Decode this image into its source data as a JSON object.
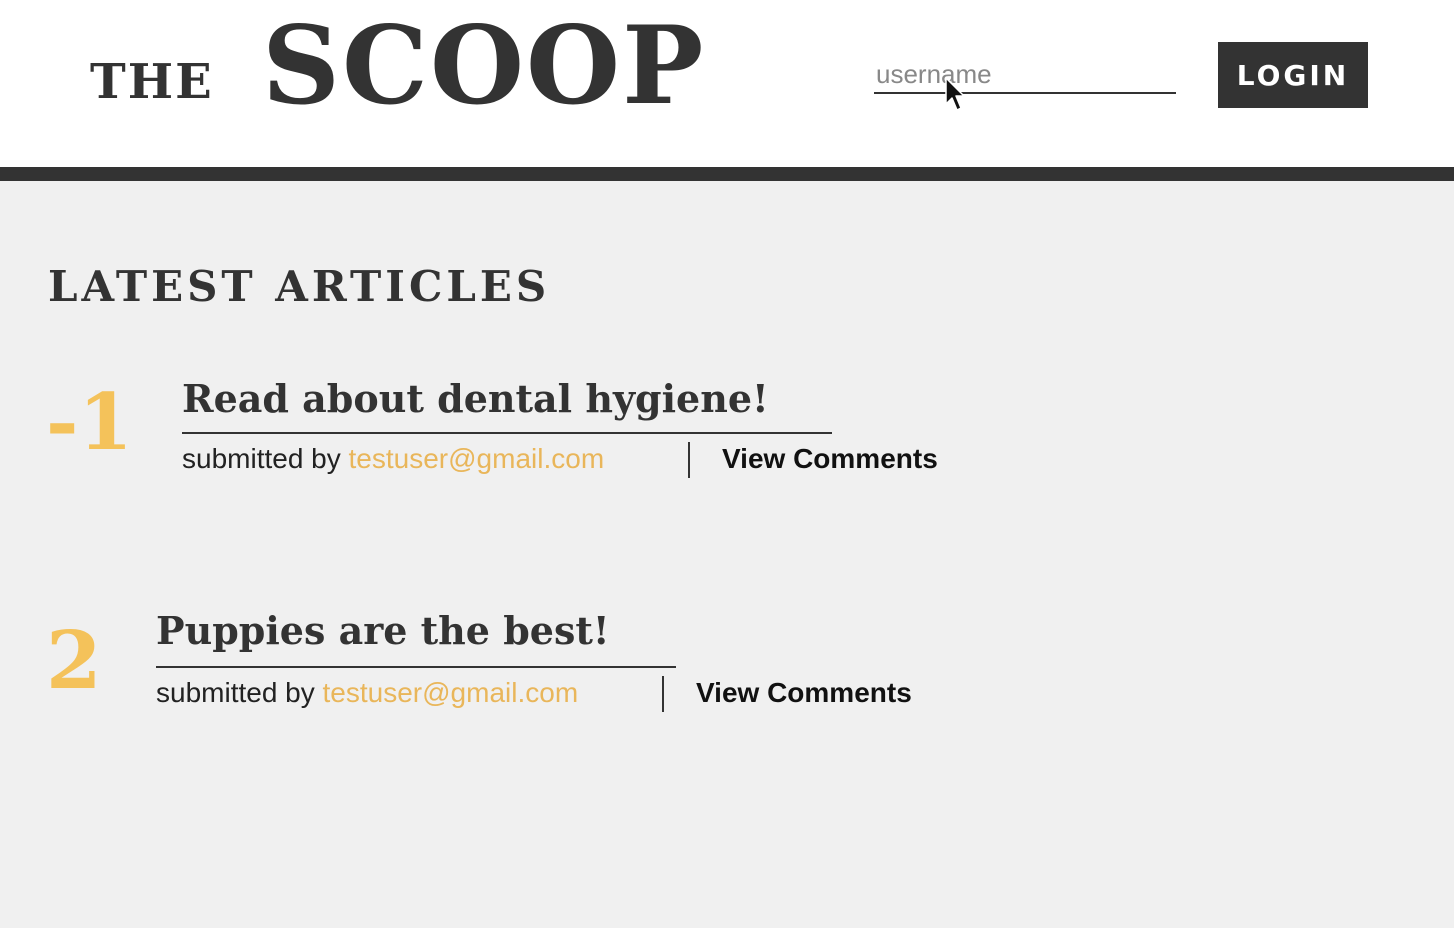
{
  "header": {
    "logo_small": "THE",
    "logo_large": "SCOOP",
    "username_placeholder": "username",
    "login_label": "LOGIN"
  },
  "main": {
    "section_title": "LATEST ARTICLES",
    "articles": [
      {
        "score": "-1",
        "title": "Read about dental hygiene!",
        "submitted_by_label": "submitted by",
        "author": "testuser@gmail.com",
        "view_comments_label": "View Comments"
      },
      {
        "score": "2",
        "title": "Puppies are the best!",
        "submitted_by_label": "submitted by",
        "author": "testuser@gmail.com",
        "view_comments_label": "View Comments"
      }
    ]
  },
  "colors": {
    "accent": "#f4c25a",
    "author_link": "#e9b65a",
    "dark": "#333333",
    "background": "#f0f0f0"
  },
  "icons": {
    "cursor": "mouse-pointer-icon"
  }
}
